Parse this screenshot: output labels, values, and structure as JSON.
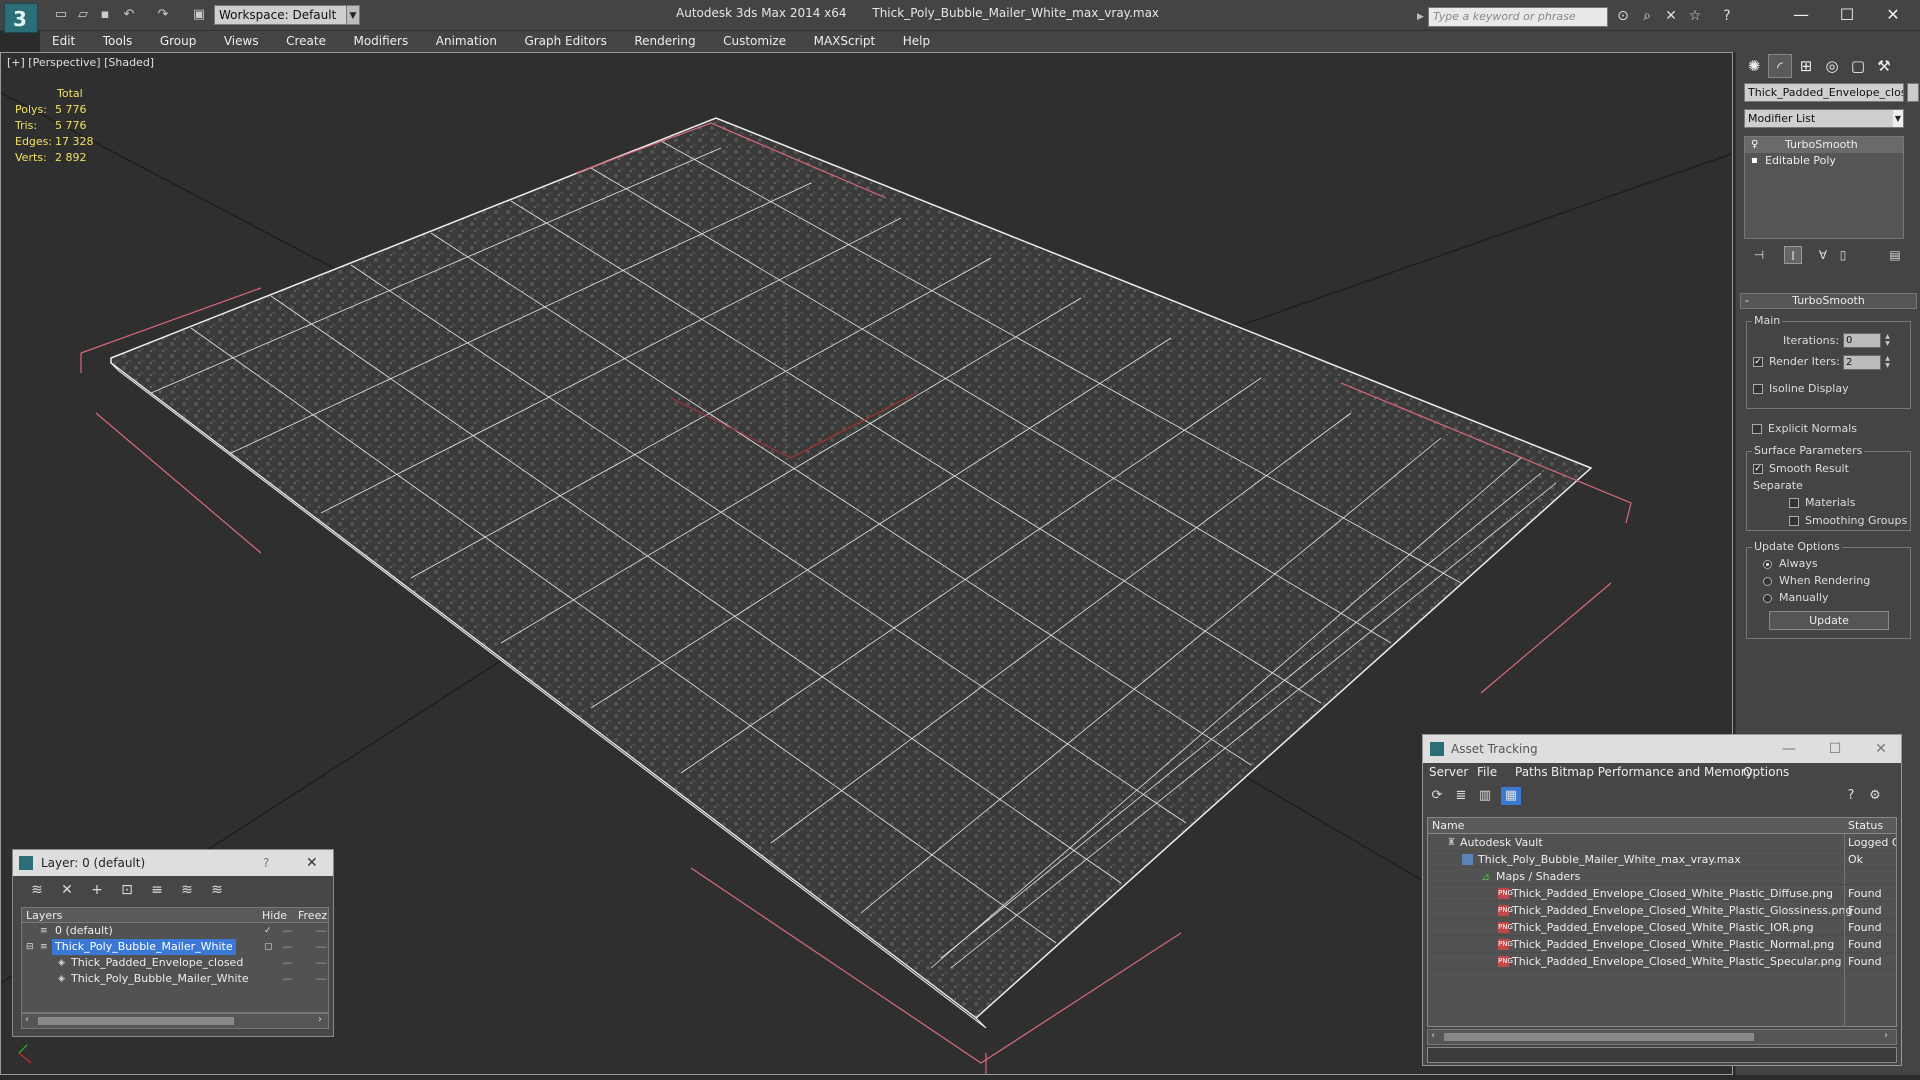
{
  "titlebar": {
    "workspace": "Workspace: Default",
    "app_title": "Autodesk 3ds Max  2014 x64",
    "file_title": "Thick_Poly_Bubble_Mailer_White_max_vray.max",
    "search_placeholder": "Type a keyword or phrase"
  },
  "menu": [
    "Edit",
    "Tools",
    "Group",
    "Views",
    "Create",
    "Modifiers",
    "Animation",
    "Graph Editors",
    "Rendering",
    "Customize",
    "MAXScript",
    "Help"
  ],
  "viewport": {
    "label": "[+] [Perspective] [Shaded]",
    "stats": {
      "header": "Total",
      "rows": [
        {
          "k": "Polys:",
          "v": "5 776"
        },
        {
          "k": "Tris:",
          "v": "5 776"
        },
        {
          "k": "Edges:",
          "v": "17 328"
        },
        {
          "k": "Verts:",
          "v": "2 892"
        }
      ]
    }
  },
  "command_panel": {
    "object_name": "Thick_Padded_Envelope_clos",
    "modifier_list": "Modifier List",
    "stack": [
      "TurboSmooth",
      "Editable Poly"
    ],
    "turbosmooth": {
      "title": "TurboSmooth",
      "main_title": "Main",
      "iterations_label": "Iterations:",
      "iterations_value": "0",
      "render_iters_label": "Render Iters:",
      "render_iters_value": "2",
      "isoline": "Isoline Display",
      "explicit_normals": "Explicit Normals",
      "surface_title": "Surface Parameters",
      "smooth_result": "Smooth Result",
      "separate": "Separate",
      "materials": "Materials",
      "smoothing_groups": "Smoothing Groups",
      "update_title": "Update Options",
      "always": "Always",
      "when_rendering": "When Rendering",
      "manually": "Manually",
      "update_button": "Update"
    }
  },
  "layer_dialog": {
    "title": "Layer: 0 (default)",
    "help": "?",
    "columns": {
      "layers": "Layers",
      "hide": "Hide",
      "freeze": "Freez"
    },
    "rows": [
      {
        "name": "0 (default)"
      },
      {
        "name": "Thick_Poly_Bubble_Mailer_White"
      },
      {
        "name": "Thick_Padded_Envelope_closed"
      },
      {
        "name": "Thick_Poly_Bubble_Mailer_White"
      }
    ]
  },
  "asset_dialog": {
    "title": "Asset Tracking",
    "menu": [
      "Server",
      "File",
      "Paths",
      "Bitmap Performance and Memory",
      "Options"
    ],
    "columns": {
      "name": "Name",
      "status": "Status"
    },
    "rows": [
      {
        "name": "Autodesk Vault",
        "status": "Logged O"
      },
      {
        "name": "Thick_Poly_Bubble_Mailer_White_max_vray.max",
        "status": "Ok"
      },
      {
        "name": "Maps / Shaders",
        "status": ""
      },
      {
        "name": "Thick_Padded_Envelope_Closed_White_Plastic_Diffuse.png",
        "status": "Found"
      },
      {
        "name": "Thick_Padded_Envelope_Closed_White_Plastic_Glossiness.png",
        "status": "Found"
      },
      {
        "name": "Thick_Padded_Envelope_Closed_White_Plastic_IOR.png",
        "status": "Found"
      },
      {
        "name": "Thick_Padded_Envelope_Closed_White_Plastic_Normal.png",
        "status": "Found"
      },
      {
        "name": "Thick_Padded_Envelope_Closed_White_Plastic_Specular.png",
        "status": "Found"
      }
    ]
  },
  "icons": {
    "png_badge": "PNG",
    "check": "✓"
  }
}
